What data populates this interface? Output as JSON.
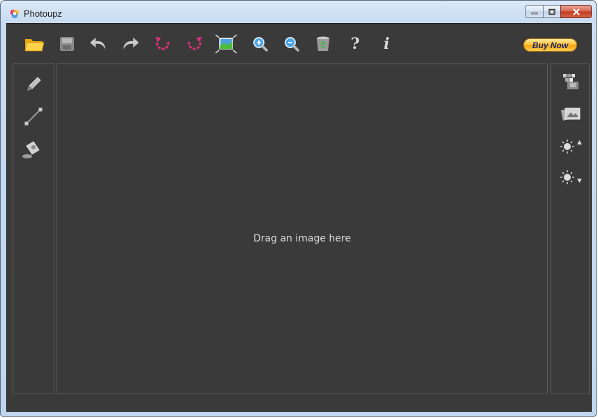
{
  "window": {
    "title": "Photoupz",
    "buttons": [
      "minimize",
      "maximize",
      "close"
    ]
  },
  "toolbar": {
    "tools": [
      {
        "name": "open-folder-icon",
        "label": "Open"
      },
      {
        "name": "save-icon",
        "label": "Save"
      },
      {
        "name": "undo-icon",
        "label": "Undo"
      },
      {
        "name": "redo-icon",
        "label": "Redo"
      },
      {
        "name": "rotate-left-icon",
        "label": "Rotate left"
      },
      {
        "name": "rotate-right-icon",
        "label": "Rotate right"
      },
      {
        "name": "fit-to-screen-icon",
        "label": "Fit"
      },
      {
        "name": "zoom-in-icon",
        "label": "Zoom in"
      },
      {
        "name": "zoom-out-icon",
        "label": "Zoom out"
      },
      {
        "name": "recycle-bin-icon",
        "label": "Delete"
      },
      {
        "name": "help-icon",
        "label": "?"
      },
      {
        "name": "info-icon",
        "label": "i"
      }
    ],
    "buy_label": "Buy Now"
  },
  "left_tools": [
    "pencil-icon",
    "line-icon",
    "paint-bucket-icon"
  ],
  "right_tools": [
    "pixelate-icon",
    "photos-icon",
    "brightness-up-icon",
    "brightness-down-icon"
  ],
  "canvas": {
    "placeholder": "Drag an image here"
  },
  "colors": {
    "background": "#3a3a3a",
    "panel_border": "#5c5c5c",
    "accent_pink": "#e0307a",
    "buy_gold": "#ffc43a"
  }
}
